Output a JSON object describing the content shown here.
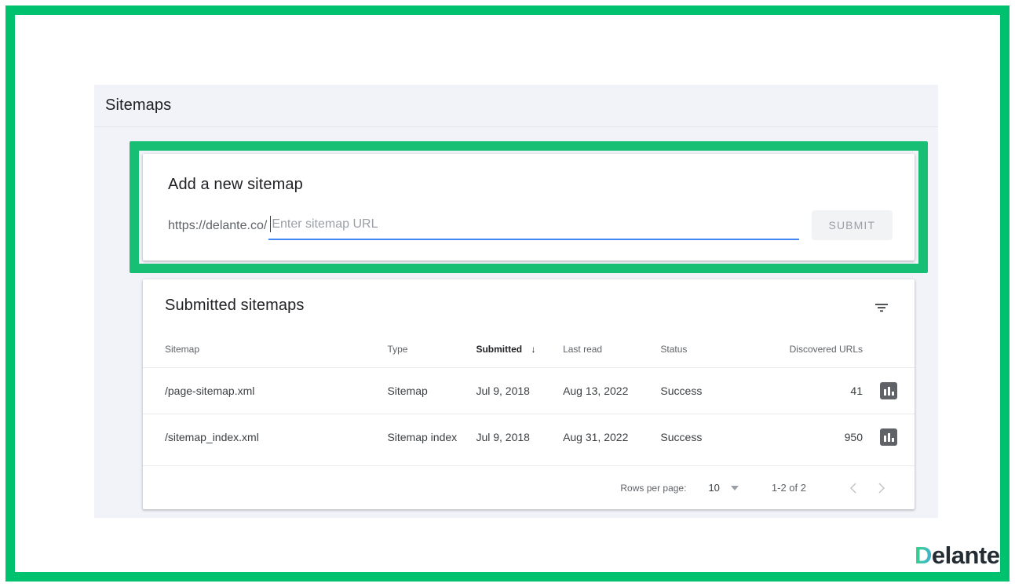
{
  "colors": {
    "annotation_green": "#17bf74",
    "frame_green": "#00c26e",
    "panel_bg": "#f1f3f9",
    "focus_blue": "#4285f4",
    "success_green": "#1e8e3e"
  },
  "panel": {
    "title": "Sitemaps"
  },
  "add_sitemap": {
    "title": "Add a new sitemap",
    "url_prefix": "https://delante.co/",
    "input_value": "",
    "input_placeholder": "Enter sitemap URL",
    "submit_label": "SUBMIT"
  },
  "submitted": {
    "title": "Submitted sitemaps",
    "filter_icon": "filter-list-icon",
    "columns": [
      {
        "label": "Sitemap",
        "sorted": false
      },
      {
        "label": "Type",
        "sorted": false
      },
      {
        "label": "Submitted",
        "sorted": true,
        "sort_arrow": "↓"
      },
      {
        "label": "Last read",
        "sorted": false
      },
      {
        "label": "Status",
        "sorted": false
      },
      {
        "label": "Discovered URLs",
        "sorted": false
      }
    ],
    "rows": [
      {
        "sitemap": "/page-sitemap.xml",
        "type": "Sitemap",
        "submitted": "Jul 9, 2018",
        "last_read": "Aug 13, 2022",
        "status": "Success",
        "discovered_urls": "41",
        "action_icon": "bar-chart-icon"
      },
      {
        "sitemap": "/sitemap_index.xml",
        "type": "Sitemap index",
        "submitted": "Jul 9, 2018",
        "last_read": "Aug 31, 2022",
        "status": "Success",
        "discovered_urls": "950",
        "action_icon": "bar-chart-icon"
      }
    ],
    "pagination": {
      "rows_per_page_label": "Rows per page:",
      "rows_per_page_value": "10",
      "range": "1-2 of 2",
      "prev_icon": "‹",
      "next_icon": "›"
    }
  },
  "logo": {
    "initial": "D",
    "rest": "elante"
  }
}
